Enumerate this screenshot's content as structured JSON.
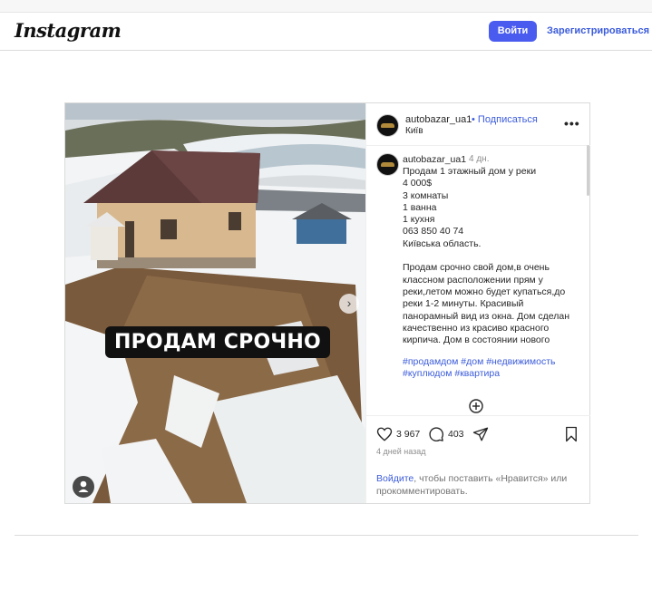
{
  "header": {
    "logo": "Instagram",
    "login_label": "Войти",
    "register_label": "Зарегистрироваться"
  },
  "post": {
    "image_overlay_text": "ПРОДАМ СРОЧНО",
    "author": {
      "username": "autobazar_ua1",
      "separator": "•",
      "follow_label": "Подписаться",
      "location": "Київ"
    },
    "caption": {
      "username": "autobazar_ua1",
      "time": "4 дн.",
      "lines": [
        "Продам 1 этажный дом у реки",
        "4 000$",
        "3 комнаты",
        "1 ванна",
        "1 кухня",
        "063 850 40 74",
        "Київська область.",
        "",
        "Продам срочно свой дом,в очень",
        "классном расположении прям у",
        "реки,летом можно будет купаться,до",
        "реки 1-2 минуты. Красивый",
        "панорамный вид из окна. Дом сделан",
        "качественно из красиво красного",
        "кирпича. Дом в состоянии нового"
      ],
      "hashtags": [
        "#продамдом #дом #недвижимость",
        "#куплюдом #квартира"
      ]
    },
    "likes": "3 967",
    "comments": "403",
    "posted_ago": "4 дней назад",
    "login_prompt": {
      "link_text": "Войдите",
      "rest_line1": ", чтобы поставить «Нравится» или",
      "rest_line2": "прокомментировать."
    },
    "icons": {
      "more": "more-options-icon",
      "heart": "heart-icon",
      "comment": "comment-icon",
      "share": "share-icon",
      "save": "bookmark-icon",
      "load_more": "plus-circle-icon",
      "next": "chevron-right-icon",
      "tagged": "user-tag-icon"
    },
    "colors": {
      "accent": "#4a5cf0",
      "link": "#3b5bdb"
    }
  }
}
